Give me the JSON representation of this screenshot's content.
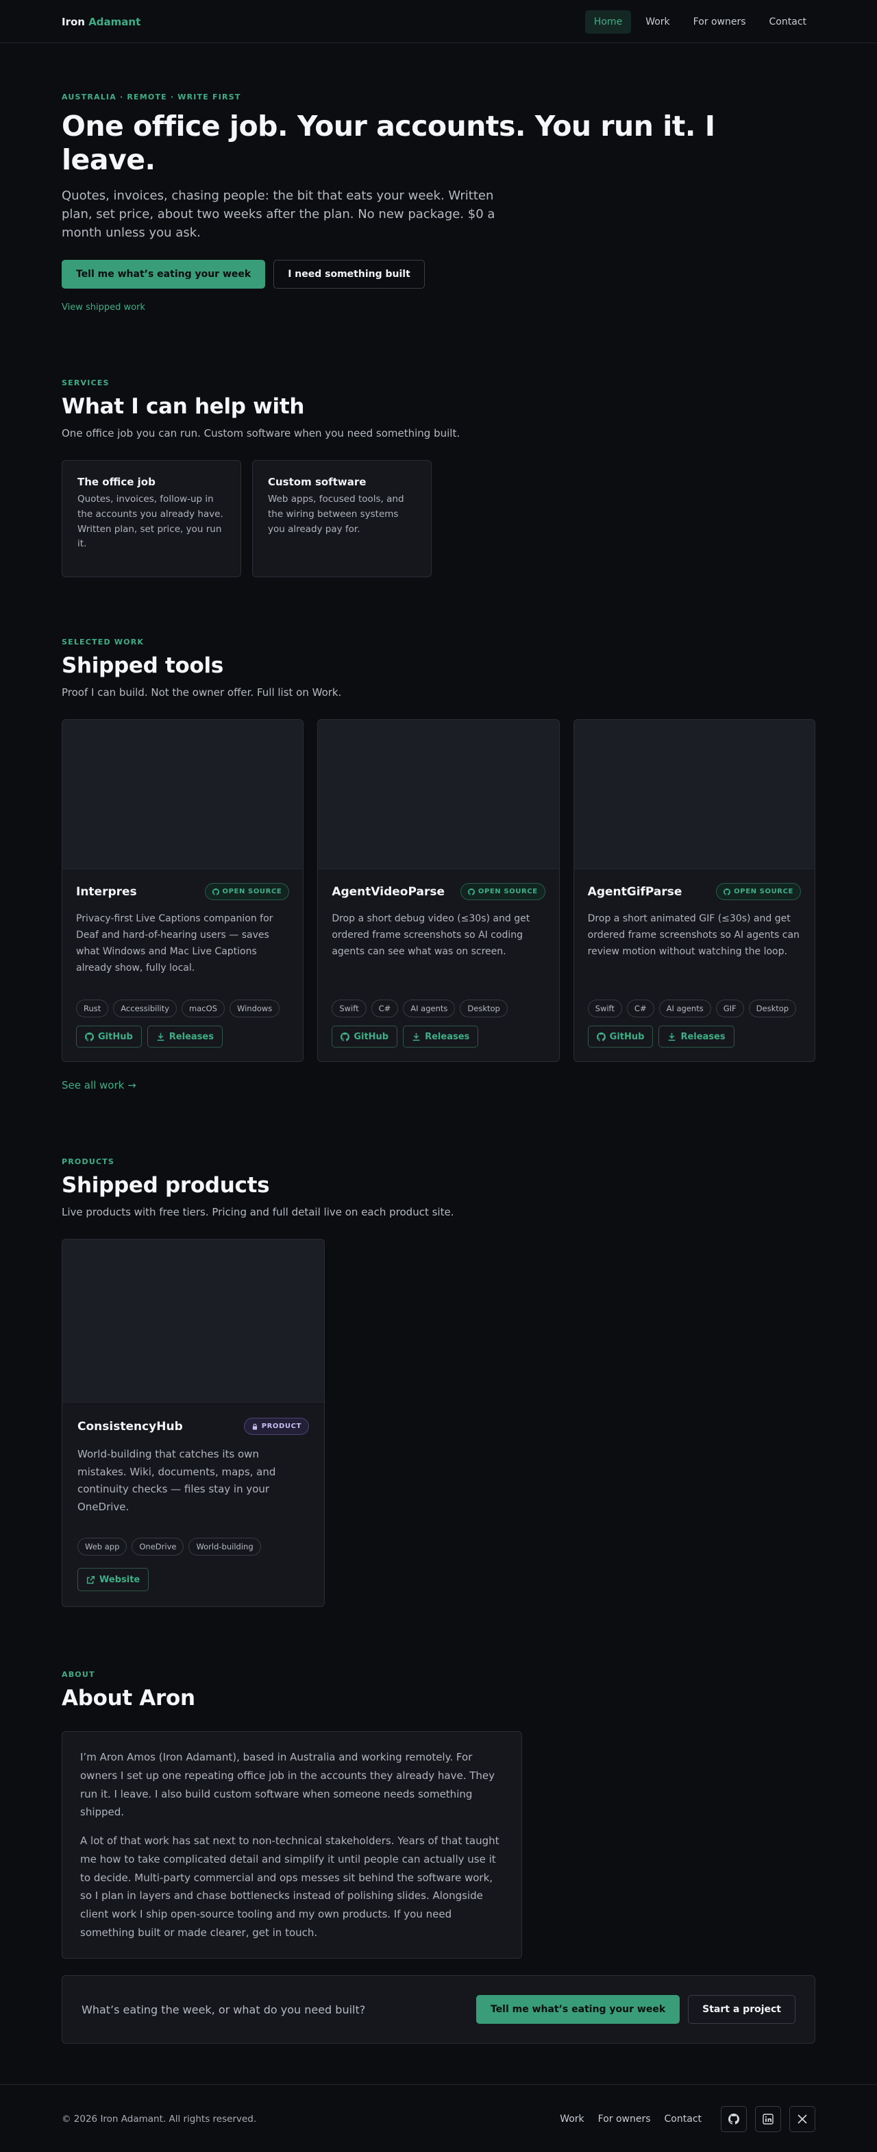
{
  "header": {
    "brand_first": "Iron",
    "brand_second": "Adamant",
    "nav": [
      {
        "label": "Home",
        "active": true
      },
      {
        "label": "Work"
      },
      {
        "label": "For owners"
      },
      {
        "label": "Contact"
      }
    ]
  },
  "hero": {
    "eyebrow": "Australia · Remote · Write first",
    "title": "One office job. Your accounts. You run it. I leave.",
    "lead": "Quotes, invoices, chasing people: the bit that eats your week. Written plan, set price, about two weeks after the plan. No new package. $0 a month unless you ask.",
    "primary_cta": "Tell me what’s eating your week",
    "secondary_cta": "I need something built",
    "link": "View shipped work"
  },
  "services": {
    "eyebrow": "Services",
    "title": "What I can help with",
    "sub": "One office job you can run. Custom software when you need something built.",
    "cards": [
      {
        "title": "The office job",
        "desc": "Quotes, invoices, follow-up in the accounts you already have. Written plan, set price, you run it."
      },
      {
        "title": "Custom software",
        "desc": "Web apps, focused tools, and the wiring between systems you already pay for."
      }
    ]
  },
  "work": {
    "eyebrow": "Selected work",
    "title": "Shipped tools",
    "sub": "Proof I can build. Not the owner offer. Full list on Work.",
    "badge_label": "OPEN SOURCE",
    "github_label": "GitHub",
    "releases_label": "Releases",
    "see_all": "See all work →",
    "items": [
      {
        "name": "Interpres",
        "desc": "Privacy-first Live Captions companion for Deaf and hard-of-hearing users — saves what Windows and Mac Live Captions already show, fully local.",
        "tags": [
          "Rust",
          "Accessibility",
          "macOS",
          "Windows"
        ]
      },
      {
        "name": "AgentVideoParse",
        "desc": "Drop a short debug video (≤30s) and get ordered frame screenshots so AI coding agents can see what was on screen.",
        "tags": [
          "Swift",
          "C#",
          "AI agents",
          "Desktop"
        ]
      },
      {
        "name": "AgentGifParse",
        "desc": "Drop a short animated GIF (≤30s) and get ordered frame screenshots so AI agents can review motion without watching the loop.",
        "tags": [
          "Swift",
          "C#",
          "AI agents",
          "GIF",
          "Desktop"
        ]
      }
    ]
  },
  "products": {
    "eyebrow": "Products",
    "title": "Shipped products",
    "sub": "Live products with free tiers. Pricing and full detail live on each product site.",
    "item": {
      "name": "ConsistencyHub",
      "badge": "PRODUCT",
      "desc": "World-building that catches its own mistakes. Wiki, documents, maps, and continuity checks — files stay in your OneDrive.",
      "tags": [
        "Web app",
        "OneDrive",
        "World-building"
      ],
      "website_label": "Website"
    }
  },
  "about": {
    "eyebrow": "About",
    "title": "About Aron",
    "p1": "I’m Aron Amos (Iron Adamant), based in Australia and working remotely. For owners I set up one repeating office job in the accounts they already have. They run it. I leave. I also build custom software when someone needs something shipped.",
    "p2": "A lot of that work has sat next to non-technical stakeholders. Years of that taught me how to take complicated detail and simplify it until people can actually use it to decide. Multi-party commercial and ops messes sit behind the software work, so I plan in layers and chase bottlenecks instead of polishing slides. Alongside client work I ship open-source tooling and my own products. If you need something built or made clearer, get in touch."
  },
  "cta_band": {
    "question": "What’s eating the week, or what do you need built?",
    "primary": "Tell me what’s eating your week",
    "secondary": "Start a project"
  },
  "footer": {
    "copyright": "© 2026 Iron Adamant. All rights reserved.",
    "links": [
      "Work",
      "For owners",
      "Contact"
    ],
    "icons": [
      "github-icon",
      "linkedin-icon",
      "x-icon"
    ]
  },
  "colors": {
    "background": "#0c0d10",
    "accent": "#3fae86",
    "card": "#15171c",
    "product_badge": "#c7bff2"
  }
}
